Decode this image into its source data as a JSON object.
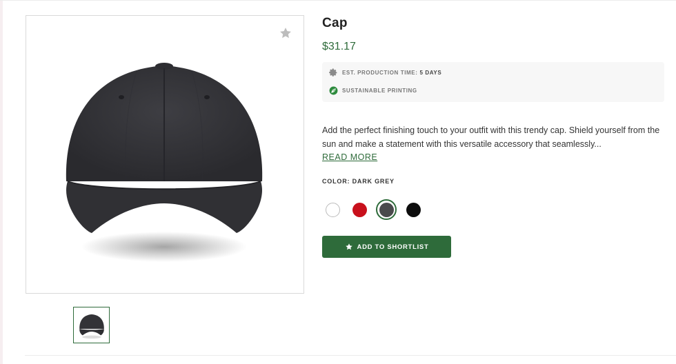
{
  "product": {
    "title": "Cap",
    "price": "$31.17",
    "image_alt": "Dark grey cap",
    "favorite_icon": "star-icon"
  },
  "meta": {
    "production_label": "EST. PRODUCTION TIME:",
    "production_value": "5 DAYS",
    "production_icon": "gear-icon",
    "sustainable_label": "SUSTAINABLE PRINTING",
    "sustainable_icon": "leaf-icon"
  },
  "description": {
    "text": "Add the perfect finishing touch to your outfit with this trendy cap. Shield yourself from the sun and make a statement with this versatile accessory that seamlessly...",
    "read_more": "READ MORE"
  },
  "color": {
    "label": "COLOR: DARK GREY",
    "selected": "Dark Grey",
    "options": [
      {
        "name": "White",
        "hex": "#ffffff"
      },
      {
        "name": "Red",
        "hex": "#c8101c"
      },
      {
        "name": "Dark Grey",
        "hex": "#4a4a4c"
      },
      {
        "name": "Black",
        "hex": "#0d0d0d"
      }
    ]
  },
  "actions": {
    "shortlist_label": "ADD TO SHORTLIST",
    "shortlist_icon": "star-icon"
  },
  "colors": {
    "brand_green": "#2e6b3a",
    "cap_dark": "#36363a"
  }
}
